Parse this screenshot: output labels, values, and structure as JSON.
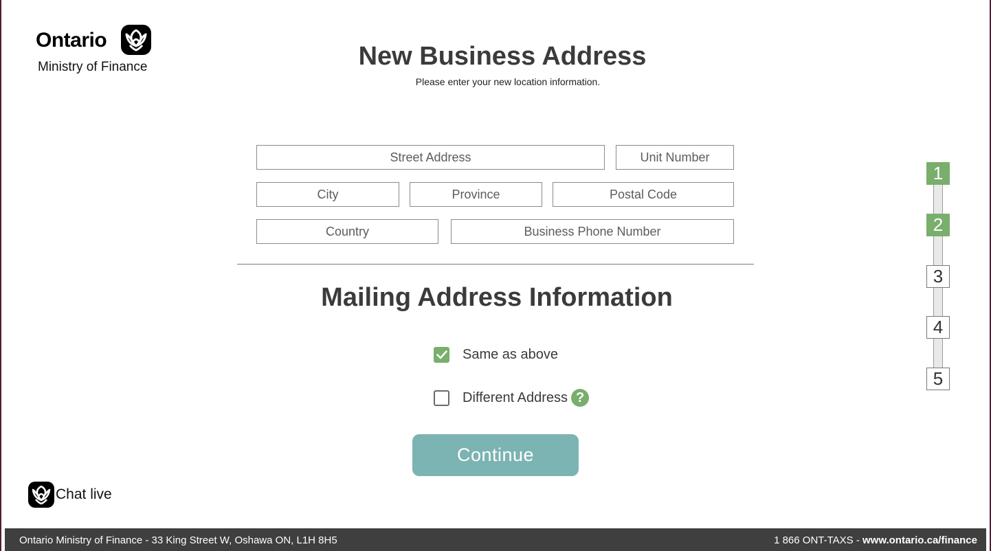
{
  "brand": {
    "wordmark": "Ontario",
    "ministry": "Ministry of Finance",
    "logo_icon": "trillium-icon"
  },
  "header": {
    "title": "New Business Address",
    "subtitle": "Please enter your new location information."
  },
  "form": {
    "street_address": {
      "placeholder": "Street Address",
      "value": ""
    },
    "unit_number": {
      "placeholder": "Unit Number",
      "value": ""
    },
    "city": {
      "placeholder": "City",
      "value": ""
    },
    "province": {
      "placeholder": "Province",
      "value": ""
    },
    "postal_code": {
      "placeholder": "Postal Code",
      "value": ""
    },
    "country": {
      "placeholder": "Country",
      "value": ""
    },
    "business_phone": {
      "placeholder": "Business Phone Number",
      "value": ""
    }
  },
  "mailing": {
    "title": "Mailing Address Information",
    "options": [
      {
        "label": "Same as above",
        "checked": true
      },
      {
        "label": "Different Address",
        "checked": false,
        "help_icon": "question-mark-icon"
      }
    ]
  },
  "actions": {
    "continue_label": "Continue"
  },
  "chat": {
    "label": "Chat live",
    "icon": "trillium-chat-icon"
  },
  "progress": {
    "steps": [
      "1",
      "2",
      "3",
      "4",
      "5"
    ],
    "completed_count": 2,
    "completed_color": "#79ae6d"
  },
  "footer": {
    "address": "Ontario Ministry of Finance - 33 King Street W, Oshawa ON,  L1H 8H5",
    "phone": "1 866 ONT-TAXS - ",
    "url": "www.ontario.ca/finance"
  },
  "colors": {
    "accent_green": "#79ae6d",
    "button_teal": "#7cb3b3",
    "footer_bg": "#3f3f3f",
    "heading": "#3b3b3b"
  }
}
